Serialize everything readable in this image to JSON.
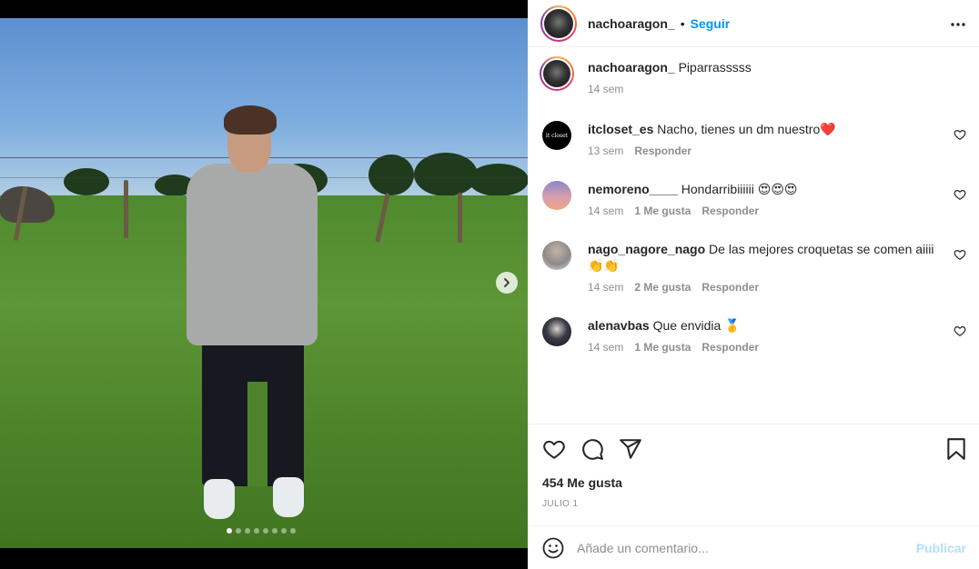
{
  "post": {
    "author": "nachoaragon_",
    "separator": "•",
    "follow_label": "Seguir",
    "more_icon": "more-horizontal-icon",
    "caption": {
      "user": "nachoaragon_",
      "text": "Piparrasssss",
      "time": "14 sem"
    },
    "carousel": {
      "slides": 8,
      "active": 1,
      "next_icon": "chevron-right-icon"
    }
  },
  "comments": [
    {
      "user": "itcloset_es",
      "text": "Nacho, tienes un dm nuestro❤️",
      "time": "13 sem",
      "likes": "",
      "reply": "Responder",
      "avatar_label": "it closet"
    },
    {
      "user": "nemoreno____",
      "text": "Hondarribiiiiii 😍😍😍",
      "time": "14 sem",
      "likes": "1 Me gusta",
      "reply": "Responder",
      "avatar_label": ""
    },
    {
      "user": "nago_nagore_nago",
      "text": "De las mejores croquetas se comen aiiii 👏👏",
      "time": "14 sem",
      "likes": "2 Me gusta",
      "reply": "Responder",
      "avatar_label": ""
    },
    {
      "user": "alenavbas",
      "text": "Que envidia 🥇",
      "time": "14 sem",
      "likes": "1 Me gusta",
      "reply": "Responder",
      "avatar_label": ""
    }
  ],
  "actions": {
    "likes": "454 Me gusta",
    "date": "JULIO 1",
    "icons": [
      "heart-icon",
      "comment-icon",
      "share-icon",
      "bookmark-icon"
    ]
  },
  "composer": {
    "placeholder": "Añade un comentario...",
    "publish_label": "Publicar",
    "emoji_icon": "emoji-icon"
  },
  "colors": {
    "link": "#0095f6",
    "publish_disabled": "#b2dffc",
    "muted": "#8e8e8e"
  }
}
